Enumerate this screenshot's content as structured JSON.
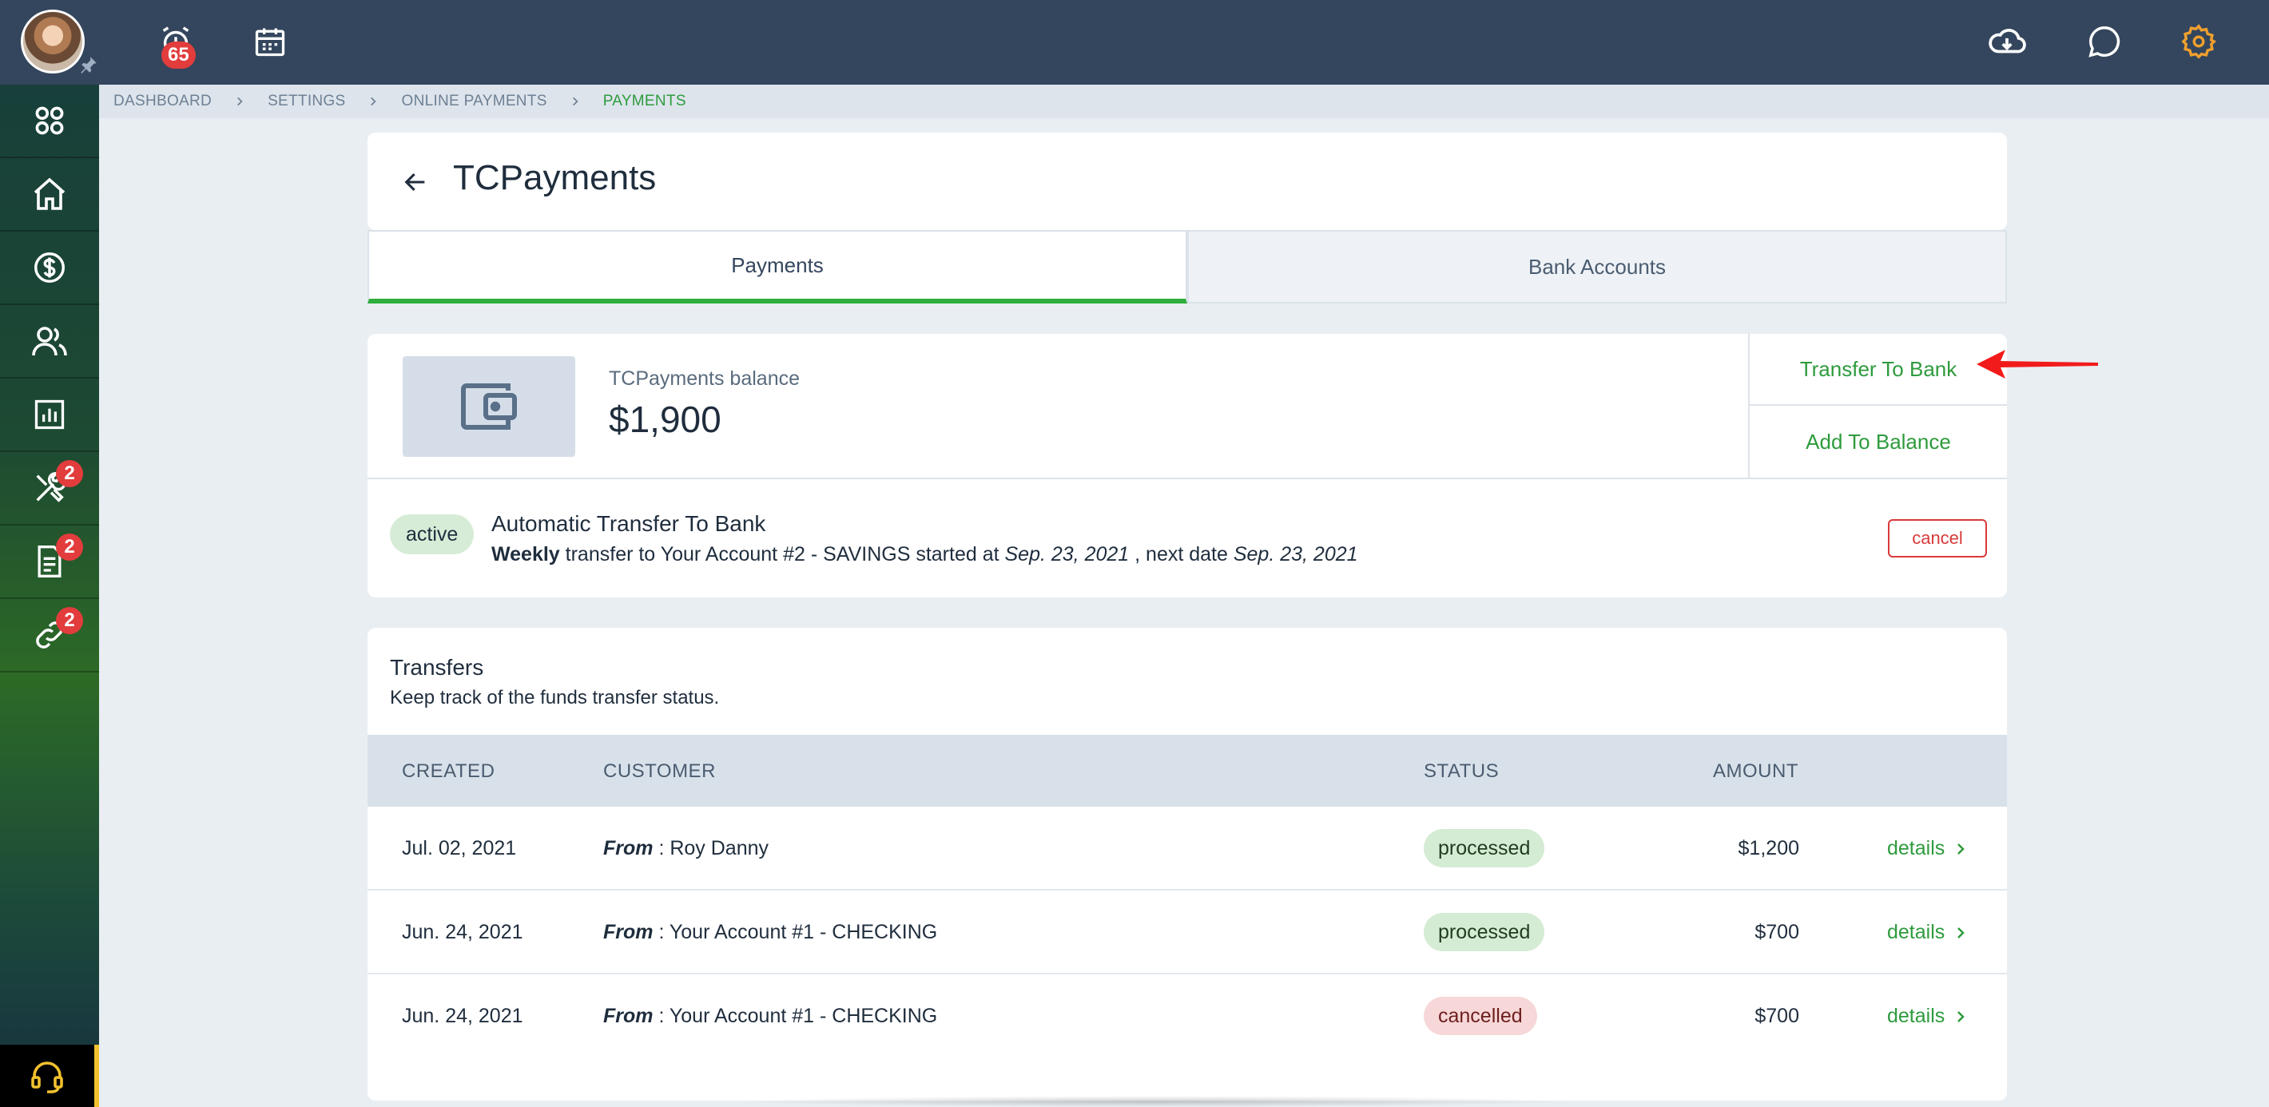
{
  "topbar": {
    "notifications_badge": "65",
    "icons": [
      "user-avatar",
      "alarm-icon",
      "calendar-icon",
      "cloud-download-icon",
      "chat-icon",
      "gear-icon"
    ],
    "accent_gear": "#f0a02e"
  },
  "sidebar": {
    "items": [
      {
        "name": "apps-icon",
        "badge": ""
      },
      {
        "name": "home-icon",
        "badge": ""
      },
      {
        "name": "dollar-icon",
        "badge": ""
      },
      {
        "name": "users-icon",
        "badge": ""
      },
      {
        "name": "reports-icon",
        "badge": ""
      },
      {
        "name": "tools-icon",
        "badge": "2"
      },
      {
        "name": "document-icon",
        "badge": "2"
      },
      {
        "name": "link-icon",
        "badge": "2"
      }
    ],
    "support_icon": "headset-icon"
  },
  "breadcrumb": {
    "items": [
      "DASHBOARD",
      "SETTINGS",
      "ONLINE PAYMENTS",
      "PAYMENTS"
    ]
  },
  "header": {
    "title": "TCPayments"
  },
  "tabs": [
    {
      "label": "Payments",
      "active": true
    },
    {
      "label": "Bank Accounts",
      "active": false
    }
  ],
  "balance": {
    "label": "TCPayments balance",
    "value": "$1,900",
    "actions": [
      "Transfer To Bank",
      "Add To Balance"
    ]
  },
  "auto_transfer": {
    "status": "active",
    "title": "Automatic Transfer To Bank",
    "frequency": "Weekly",
    "text_1": " transfer to Your Account #2 - SAVINGS started at ",
    "start_date": "Sep. 23, 2021",
    "text_2": " , next date ",
    "next_date": "Sep. 23, 2021",
    "cancel_label": "cancel"
  },
  "transfers": {
    "title": "Transfers",
    "subtitle": "Keep track of the funds transfer status.",
    "columns": [
      "CREATED",
      "CUSTOMER",
      "STATUS",
      "AMOUNT"
    ],
    "from_label": "From",
    "rows": [
      {
        "created": "Jul. 02, 2021",
        "customer": " : Roy Danny",
        "status": "processed",
        "amount": "$1,200",
        "details": "details"
      },
      {
        "created": "Jun. 24, 2021",
        "customer": " : Your Account #1 - CHECKING",
        "status": "processed",
        "amount": "$700",
        "details": "details"
      },
      {
        "created": "Jun. 24, 2021",
        "customer": " : Your Account #1 - CHECKING",
        "status": "cancelled",
        "amount": "$700",
        "details": "details"
      }
    ]
  },
  "colors": {
    "topbar": "#34465d",
    "accent_green": "#2e9b3d",
    "danger": "#d83a3a"
  }
}
